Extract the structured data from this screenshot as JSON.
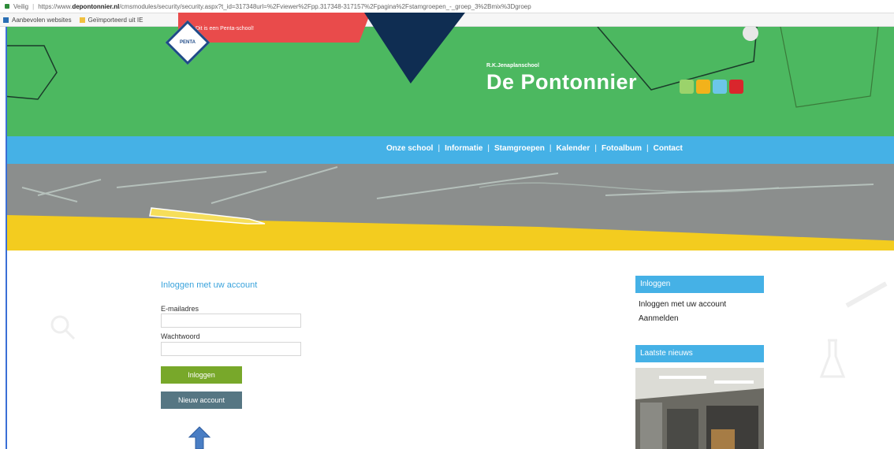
{
  "browser": {
    "status": "Veilig",
    "url_prefix": "https://www.",
    "url_host": "depontonnier.nl",
    "url_rest": "/cmsmodules/security/security.aspx?t_id=317348url=%2Fviewer%2Fpp.317348-317157%2Fpagina%2Fstamgroepen_-_groep_3%2Bmix%3Dgroep",
    "bookmarks": [
      "Aanbevolen websites",
      "Geïmporteerd uit IE"
    ]
  },
  "header": {
    "tagline": "Dit is een Penta-school!",
    "logo_text": "PENTA",
    "school_type": "R.K.Jenaplanschool",
    "school_name": "De Pontonnier"
  },
  "nav": {
    "items": [
      "Onze school",
      "Informatie",
      "Stamgroepen",
      "Kalender",
      "Fotoalbum",
      "Contact"
    ],
    "separator": "|"
  },
  "login": {
    "title": "Inloggen met uw account",
    "email_label": "E-mailadres",
    "email_value": "",
    "password_label": "Wachtwoord",
    "password_value": "",
    "login_button": "Inloggen",
    "new_account_button": "Nieuw account"
  },
  "sidebar": {
    "login_heading": "Inloggen",
    "login_links": [
      "Inloggen met uw account",
      "Aanmelden"
    ],
    "news_heading": "Laatste nieuws"
  },
  "colors": {
    "header_green": "#4cb860",
    "nav_blue": "#45b1e6",
    "banner_yellow": "#f3cc1f",
    "login_button": "#78a82a",
    "new_account_button": "#567683",
    "arrow": "#4a7ec4"
  },
  "icons": [
    "lock-icon",
    "bookmark-icon",
    "folder-icon",
    "penta-logo",
    "up-arrow-annotation-icon"
  ]
}
